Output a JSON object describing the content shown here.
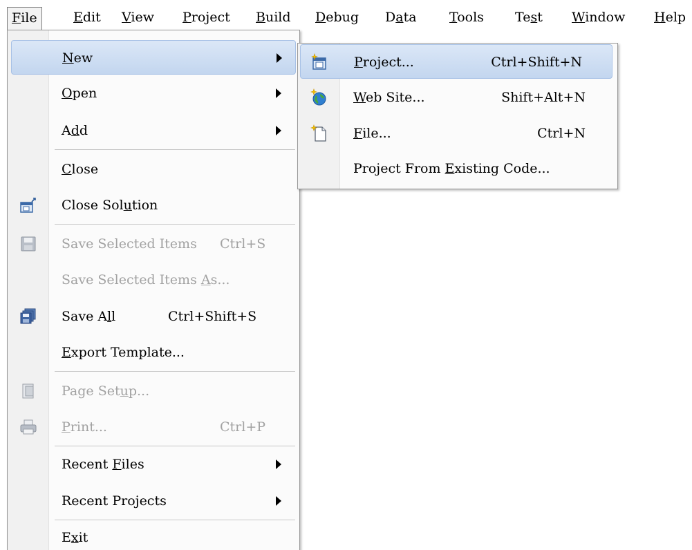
{
  "menubar": {
    "items": [
      {
        "pre": "",
        "mn": "F",
        "post": "ile"
      },
      {
        "pre": "",
        "mn": "E",
        "post": "dit"
      },
      {
        "pre": "",
        "mn": "V",
        "post": "iew"
      },
      {
        "pre": "",
        "mn": "P",
        "post": "roject"
      },
      {
        "pre": "",
        "mn": "B",
        "post": "uild"
      },
      {
        "pre": "",
        "mn": "D",
        "post": "ebug"
      },
      {
        "pre": "D",
        "mn": "a",
        "post": "ta"
      },
      {
        "pre": "",
        "mn": "T",
        "post": "ools"
      },
      {
        "pre": "Te",
        "mn": "s",
        "post": "t"
      },
      {
        "pre": "",
        "mn": "W",
        "post": "indow"
      },
      {
        "pre": "",
        "mn": "H",
        "post": "elp"
      }
    ]
  },
  "file_menu": {
    "items": [
      {
        "pre": "",
        "mn": "N",
        "post": "ew"
      },
      {
        "pre": "",
        "mn": "O",
        "post": "pen"
      },
      {
        "pre": "A",
        "mn": "d",
        "post": "d"
      },
      {
        "pre": "",
        "mn": "C",
        "post": "lose"
      },
      {
        "pre": "Close Sol",
        "mn": "u",
        "post": "tion"
      },
      {
        "pre": "Save Selected Items",
        "mn": "",
        "post": "",
        "shortcut": "Ctrl+S"
      },
      {
        "pre": "Save Selected Items ",
        "mn": "A",
        "post": "s..."
      },
      {
        "pre": "Save A",
        "mn": "l",
        "post": "l",
        "shortcut": "Ctrl+Shift+S"
      },
      {
        "pre": "",
        "mn": "E",
        "post": "xport Template..."
      },
      {
        "pre": "Page Set",
        "mn": "u",
        "post": "p..."
      },
      {
        "pre": "",
        "mn": "P",
        "post": "rint...",
        "shortcut": "Ctrl+P"
      },
      {
        "pre": "Recent ",
        "mn": "F",
        "post": "iles"
      },
      {
        "pre": "Recent Pro",
        "mn": "j",
        "post": "ects"
      },
      {
        "pre": "E",
        "mn": "x",
        "post": "it"
      }
    ]
  },
  "new_submenu": {
    "items": [
      {
        "pre": "",
        "mn": "P",
        "post": "roject...",
        "shortcut": "Ctrl+Shift+N"
      },
      {
        "pre": "",
        "mn": "W",
        "post": "eb Site...",
        "shortcut": "Shift+Alt+N"
      },
      {
        "pre": "",
        "mn": "F",
        "post": "ile...",
        "shortcut": "Ctrl+N"
      },
      {
        "pre": "Project From ",
        "mn": "E",
        "post": "xisting Code..."
      }
    ]
  },
  "colors": {
    "highlight": "#c8daf2",
    "highlight_border": "#a7c1e6",
    "disabled_text": "#a2a2a2",
    "menu_background": "#fbfbfb",
    "gutter": "#f1f1f1"
  }
}
